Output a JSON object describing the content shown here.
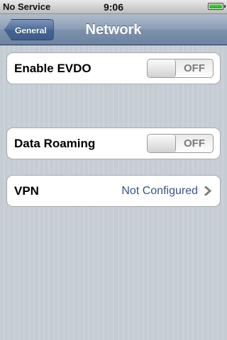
{
  "status_bar": {
    "carrier": "No Service",
    "time": "9:06",
    "battery_level": 1.0,
    "battery_icon": "battery-icon"
  },
  "nav": {
    "back_label": "General",
    "title": "Network"
  },
  "cells": {
    "evdo": {
      "label": "Enable EVDO",
      "toggle_state": "OFF"
    },
    "roaming": {
      "label": "Data Roaming",
      "toggle_state": "OFF"
    },
    "vpn": {
      "label": "VPN",
      "value": "Not Configured",
      "accessory_icon": "chevron-right-icon"
    }
  },
  "colors": {
    "background": "#c5ccd4",
    "nav_bar": "#6d84a2",
    "value_text": "#385487"
  }
}
